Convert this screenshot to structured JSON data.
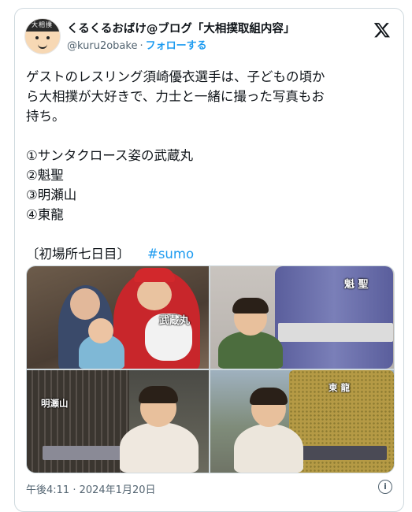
{
  "author": {
    "display_name": "くるくるおばけ@ブログ「大相撲取組内容」",
    "handle": "@kuru2obake",
    "separator": "·",
    "follow_label": "フォローする",
    "avatar_text": "大相撲"
  },
  "post": {
    "lines": [
      "ゲストのレスリング須崎優衣選手は、子どもの頃か",
      "ら大相撲が大好きで、力士と一緒に撮った写真もお",
      "持ち。"
    ],
    "list": [
      "①サンタクロース姿の武蔵丸",
      "②魁聖",
      "③明瀬山",
      "④東龍"
    ],
    "footer_text": "〔初場所七日目〕",
    "hashtag": "#sumo"
  },
  "photos": [
    {
      "label": "武蔵丸"
    },
    {
      "label": "魁 聖"
    },
    {
      "label": "明瀬山"
    },
    {
      "label": "東 龍"
    }
  ],
  "timestamp": "午後4:11 · 2024年1月20日",
  "colors": {
    "accent": "#1d9bf0",
    "muted": "#536471",
    "border": "#cfd9de"
  },
  "icons": {
    "brand": "x-logo-icon",
    "info": "info-icon"
  }
}
